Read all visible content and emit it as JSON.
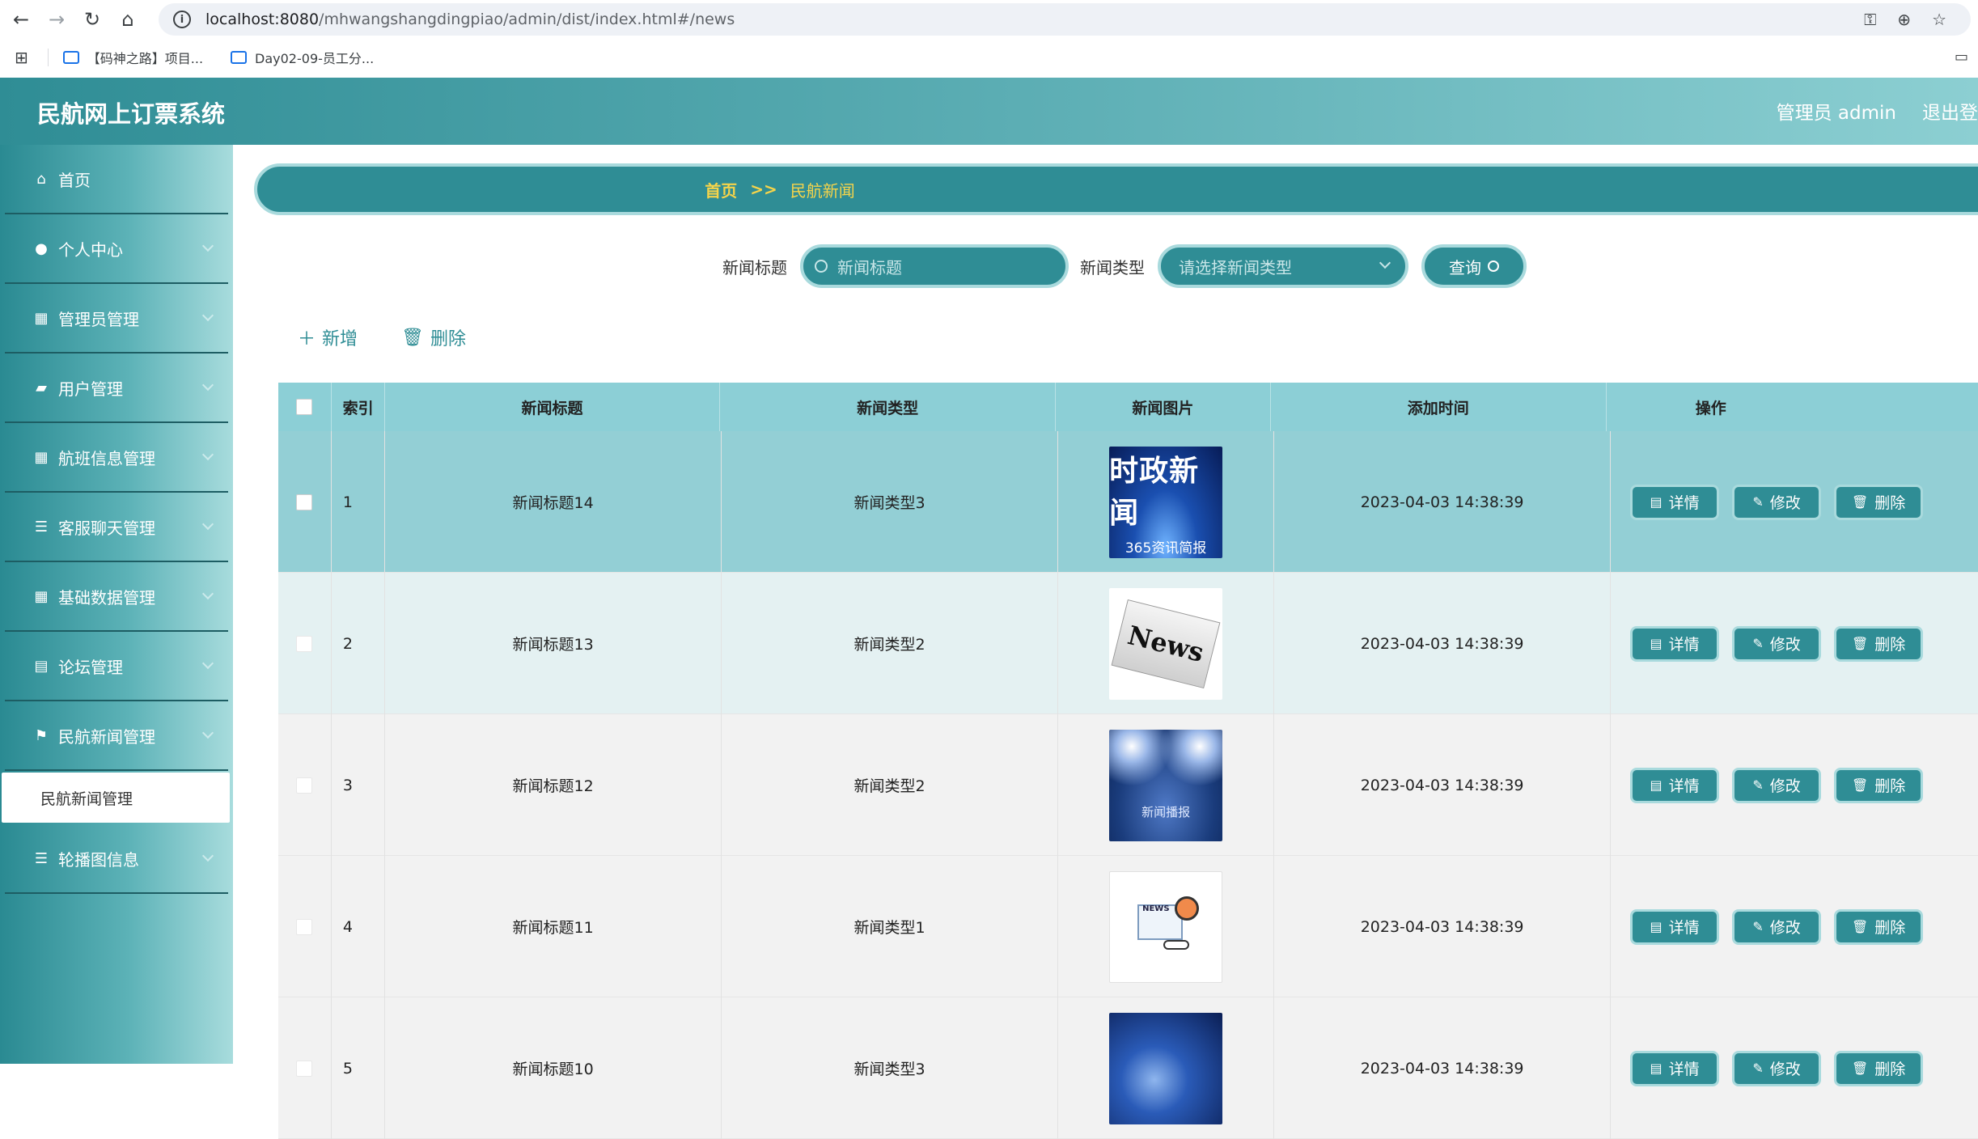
{
  "browser": {
    "url_host": "localhost:8080",
    "url_path": "/mhwangshangdingpiao/admin/dist/index.html#/news",
    "bookmarks": [
      "【码神之路】项目...",
      "Day02-09-员工分..."
    ]
  },
  "header": {
    "brand": "民航网上订票系统",
    "user": "管理员 admin",
    "logout": "退出登"
  },
  "sidebar": {
    "items": [
      {
        "label": "首页",
        "icon": "home-icon"
      },
      {
        "label": "个人中心",
        "icon": "user-icon"
      },
      {
        "label": "管理员管理",
        "icon": "grid-icon"
      },
      {
        "label": "用户管理",
        "icon": "users-icon"
      },
      {
        "label": "航班信息管理",
        "icon": "grid-icon"
      },
      {
        "label": "客服聊天管理",
        "icon": "list-icon"
      },
      {
        "label": "基础数据管理",
        "icon": "grid-icon"
      },
      {
        "label": "论坛管理",
        "icon": "clipboard-icon"
      },
      {
        "label": "民航新闻管理",
        "icon": "flag-icon"
      },
      {
        "label": "轮播图信息",
        "icon": "list-icon"
      }
    ],
    "sub_item": "民航新闻管理"
  },
  "breadcrumb": {
    "home": "首页",
    "sep": ">>",
    "current": "民航新闻"
  },
  "search": {
    "title_label": "新闻标题",
    "title_placeholder": "新闻标题",
    "type_label": "新闻类型",
    "type_placeholder": "请选择新闻类型",
    "query_label": "查询"
  },
  "actions": {
    "add": "新增",
    "delete": "删除"
  },
  "table": {
    "headers": [
      "索引",
      "新闻标题",
      "新闻类型",
      "新闻图片",
      "添加时间",
      "操作"
    ],
    "rows": [
      {
        "index": "1",
        "title": "新闻标题14",
        "type": "新闻类型3",
        "time": "2023-04-03 14:38:39",
        "img_text": "时政新闻",
        "img_sub": "365资讯简报"
      },
      {
        "index": "2",
        "title": "新闻标题13",
        "type": "新闻类型2",
        "time": "2023-04-03 14:38:39",
        "img_text": "News",
        "img_sub": ""
      },
      {
        "index": "3",
        "title": "新闻标题12",
        "type": "新闻类型2",
        "time": "2023-04-03 14:38:39",
        "img_text": "新闻播报",
        "img_sub": ""
      },
      {
        "index": "4",
        "title": "新闻标题11",
        "type": "新闻类型1",
        "time": "2023-04-03 14:38:39",
        "img_text": "NEWS",
        "img_sub": ""
      },
      {
        "index": "5",
        "title": "新闻标题10",
        "type": "新闻类型3",
        "time": "2023-04-03 14:38:39",
        "img_text": "",
        "img_sub": ""
      }
    ],
    "ops": {
      "detail": "详情",
      "edit": "修改",
      "delete": "删除"
    }
  },
  "colors": {
    "primary": "#2f8d95",
    "header_row": "#8ccfd6",
    "crumb_text": "#f5d44a"
  }
}
